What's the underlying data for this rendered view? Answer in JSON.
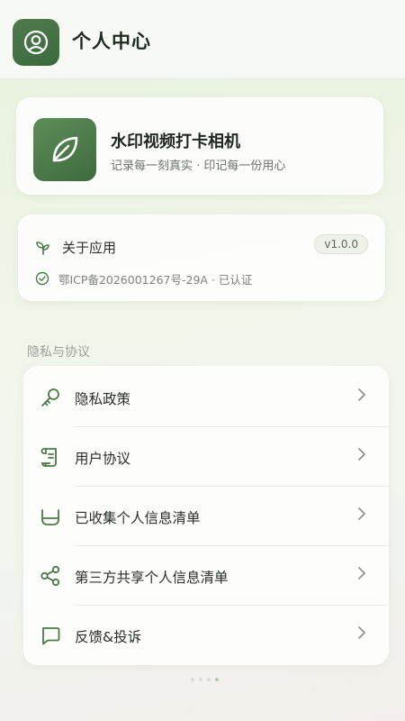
{
  "header": {
    "title": "个人中心",
    "avatar_icon": "user-circle-icon"
  },
  "app_card": {
    "logo_icon": "leaf-icon",
    "name": "水印视频打卡相机",
    "slogan": "记录每一刻真实 · 印记每一份用心"
  },
  "about": {
    "icon": "sprout-icon",
    "title": "关于应用",
    "version": "v1.0.0",
    "icp_icon": "verified-check-icon",
    "icp": "鄂ICP备2026001267号-29A · 已认证"
  },
  "section": {
    "privacy_label": "隐私与协议"
  },
  "menu": {
    "items": [
      {
        "icon": "key-icon",
        "label": "隐私政策"
      },
      {
        "icon": "scroll-icon",
        "label": "用户协议"
      },
      {
        "icon": "tray-icon",
        "label": "已收集个人信息清单"
      },
      {
        "icon": "share-icon",
        "label": "第三方共享个人信息清单"
      },
      {
        "icon": "chat-icon",
        "label": "反馈&投诉"
      }
    ]
  },
  "colors": {
    "accent": "#456f43",
    "icon_green": "#4a7a47",
    "text_primary": "#283028",
    "text_secondary": "#7d847d"
  }
}
